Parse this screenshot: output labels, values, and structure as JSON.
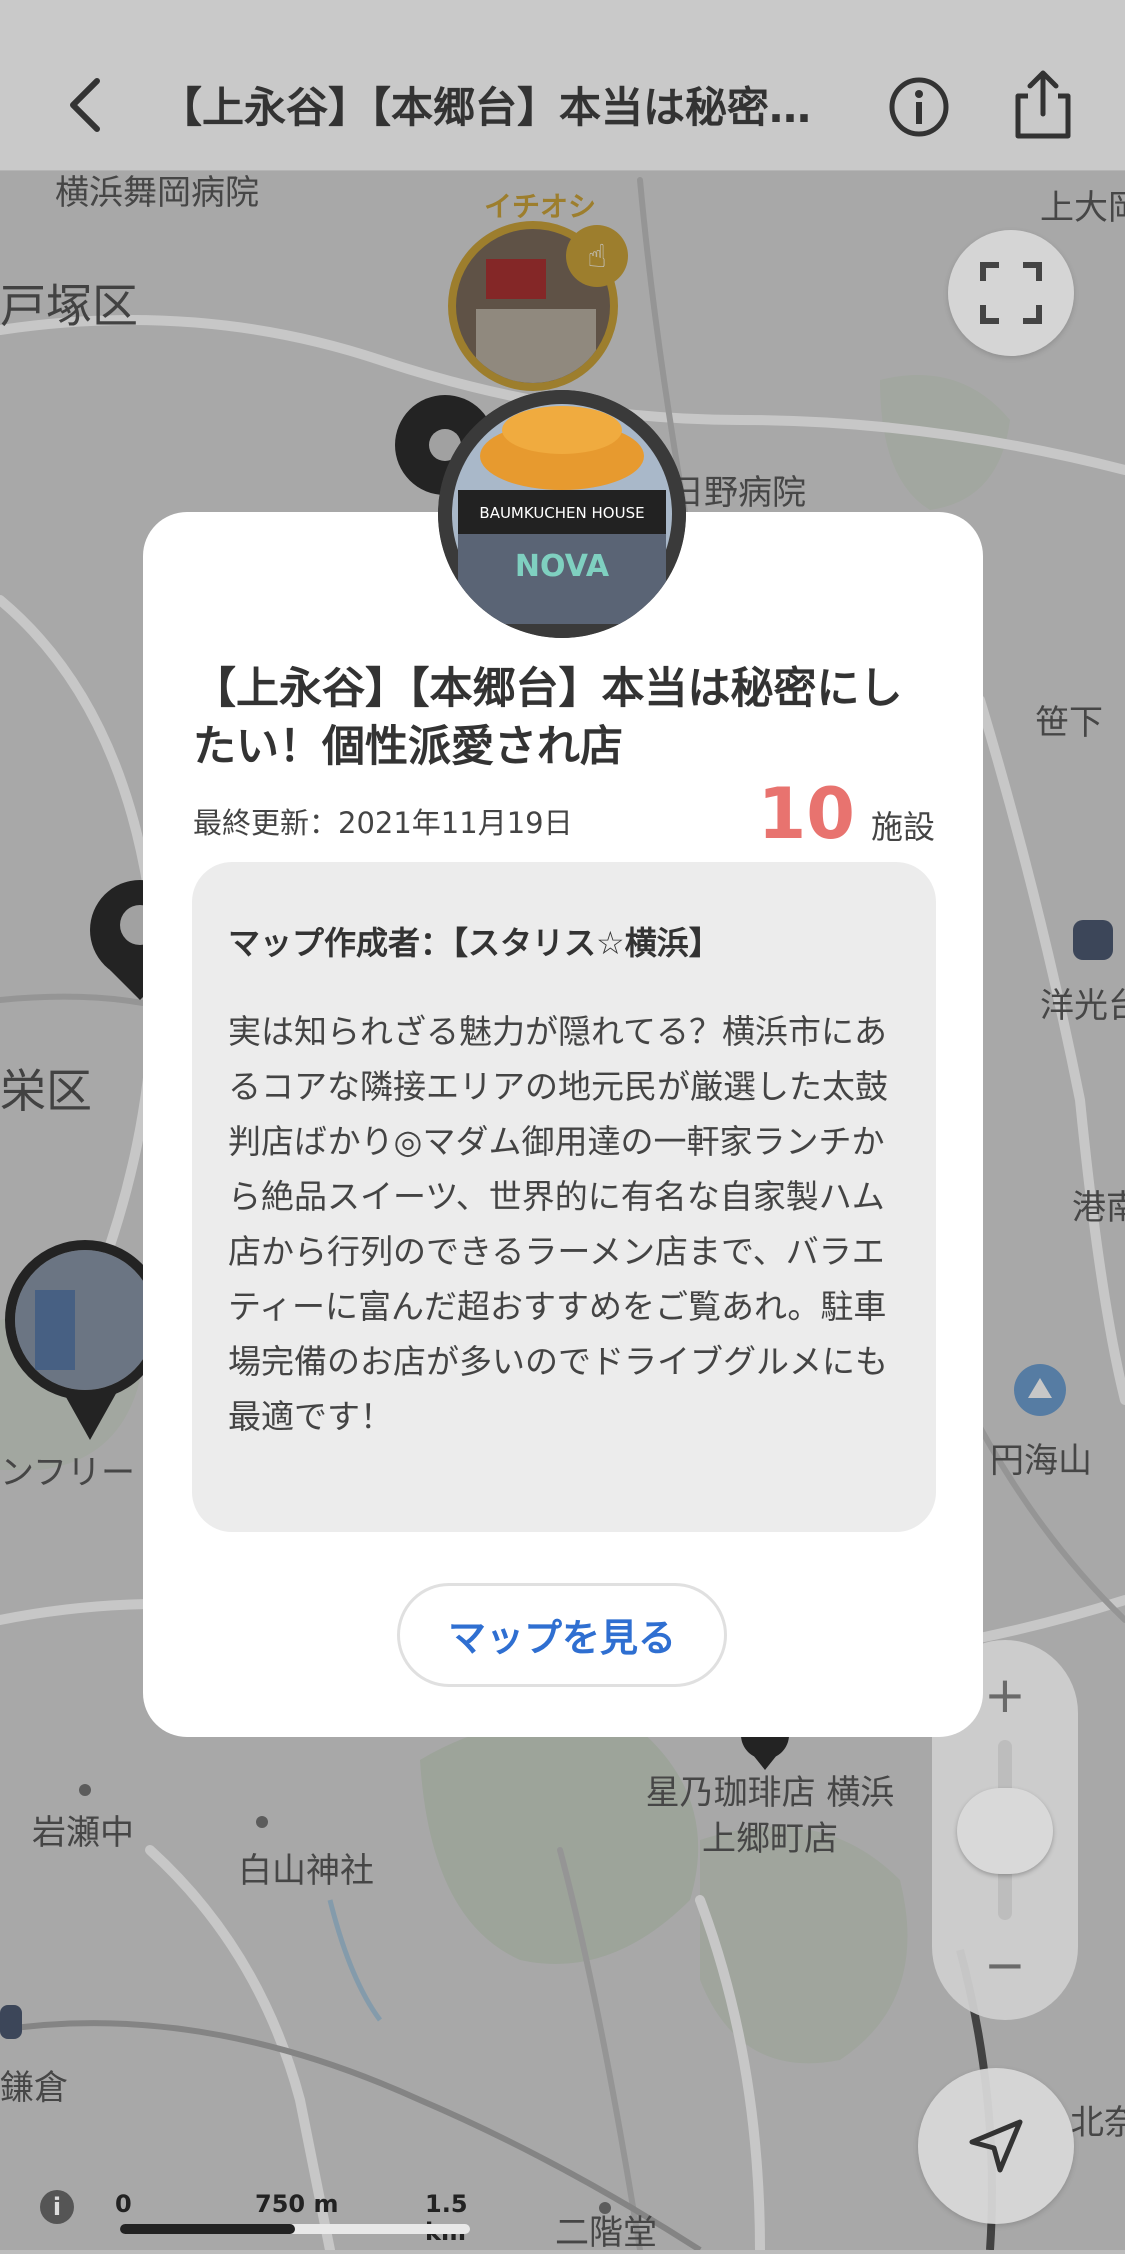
{
  "header": {
    "title": "【上永谷】【本郷台】本当は秘密…"
  },
  "map": {
    "labels": {
      "hospital_top": "横浜舞岡病院",
      "totsuka": "戸塚区",
      "sakae": "栄区",
      "hino": "日野病院",
      "sasage": "笹下",
      "youkoudai": "洋光台",
      "kounan": "港南",
      "enkaizan": "円海山",
      "iwase": "岩瀬中",
      "hakusan": "白山神社",
      "hoshino": "星乃珈琲店 横浜上郷町店",
      "nikaido": "二階堂",
      "kamakura": "鎌倉",
      "kita": "北奈",
      "kamio": "上大岡",
      "nfuri": "ンフリー"
    },
    "recommend_badge": "イチオシ",
    "scale": {
      "zero": "0",
      "mid": "750 m",
      "end": "1.5 km"
    },
    "zoom_in": "+",
    "zoom_out": "−"
  },
  "card": {
    "title": "【上永谷】【本郷台】本当は秘密にしたい！個性派愛され店",
    "updated": "最終更新：2021年11月19日",
    "count": "10",
    "count_unit": "施設",
    "author": "マップ作成者：【スタリス☆横浜】",
    "description": "実は知られざる魅力が隠れてる？横浜市にあるコアな隣接エリアの地元民が厳選した太鼓判店ばかり◎マダム御用達の一軒家ランチから絶品スイーツ、世界的に有名な自家製ハム店から行列のできるラーメン店まで、バラエティーに富んだ超おすすめをご覧あれ。駐車場完備のお店が多いのでドライブグルメにも最適です！",
    "view_button": "マップを見る",
    "avatar_sign": "BAUMKUCHEN HOUSE",
    "avatar_brand": "NOVA"
  }
}
